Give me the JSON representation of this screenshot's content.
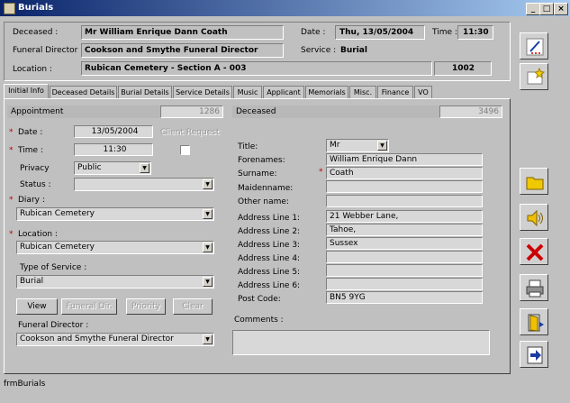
{
  "window": {
    "title": "Burials",
    "minimize": "_",
    "maximize": "□",
    "close": "×"
  },
  "header": {
    "deceased_label": "Deceased :",
    "deceased_value": "Mr William Enrique Dann Coath",
    "funeral_director_label": "Funeral Director :",
    "funeral_director_value": "Cookson and Smythe Funeral Director",
    "location_label": "Location :",
    "location_value": "Rubican Cemetery - Section A - 003",
    "location_code": "1002",
    "date_label": "Date :",
    "date_value": "Thu, 13/05/2004",
    "time_label": "Time :",
    "time_value": "11:30",
    "service_label": "Service :",
    "service_value": "Burial"
  },
  "tabs": [
    {
      "label": "Initial Info",
      "active": true
    },
    {
      "label": "Deceased Details"
    },
    {
      "label": "Burial Details"
    },
    {
      "label": "Service Details"
    },
    {
      "label": "Music"
    },
    {
      "label": "Applicant"
    },
    {
      "label": "Memorials"
    },
    {
      "label": "Misc."
    },
    {
      "label": "Finance"
    },
    {
      "label": "VO"
    }
  ],
  "appointment": {
    "header": "Appointment",
    "id": "1286",
    "date_label": "Date :",
    "date_value": "13/05/2004",
    "time_label": "Time :",
    "time_value": "11:30",
    "client_request_label": "Client Request",
    "privacy_label": "Privacy",
    "privacy_value": "Public",
    "status_label": "Status :",
    "status_value": "",
    "diary_label": "Diary :",
    "diary_value": "Rubican Cemetery",
    "location_label": "Location :",
    "location_value": "Rubican Cemetery",
    "type_label": "Type of Service :",
    "type_value": "Burial",
    "buttons": {
      "view": "View",
      "funeral_dir": "Funeral Dir.",
      "priority": "Priority",
      "clear": "Clear"
    },
    "fd_label": "Funeral Director :",
    "fd_value": "Cookson and Smythe Funeral Director"
  },
  "deceased": {
    "header": "Deceased",
    "id": "3496",
    "title_label": "Title:",
    "title_value": "Mr",
    "forenames_label": "Forenames:",
    "forenames_value": "William Enrique Dann",
    "surname_label": "Surname:",
    "surname_value": "Coath",
    "maidenname_label": "Maidenname:",
    "maidenname_value": "",
    "othername_label": "Other name:",
    "othername_value": "",
    "addr1_label": "Address Line 1:",
    "addr1_value": "21 Webber Lane,",
    "addr2_label": "Address Line 2:",
    "addr2_value": "Tahoe,",
    "addr3_label": "Address Line 3:",
    "addr3_value": "Sussex",
    "addr4_label": "Address Line 4:",
    "addr4_value": "",
    "addr5_label": "Address Line 5:",
    "addr5_value": "",
    "addr6_label": "Address Line 6:",
    "addr6_value": "",
    "postcode_label": "Post Code:",
    "postcode_value": "BN5 9YG",
    "comments_label": "Comments :",
    "comments_value": ""
  },
  "sidebar_icons": [
    "pencil-edit-icon",
    "new-record-icon",
    "folder-icon",
    "audio-speaker-icon",
    "delete-x-icon",
    "print-icon",
    "exit-door-icon",
    "exit-arrow-icon"
  ],
  "status": {
    "text": "frmBurials"
  },
  "req_mark": "*",
  "arrow": "▼"
}
